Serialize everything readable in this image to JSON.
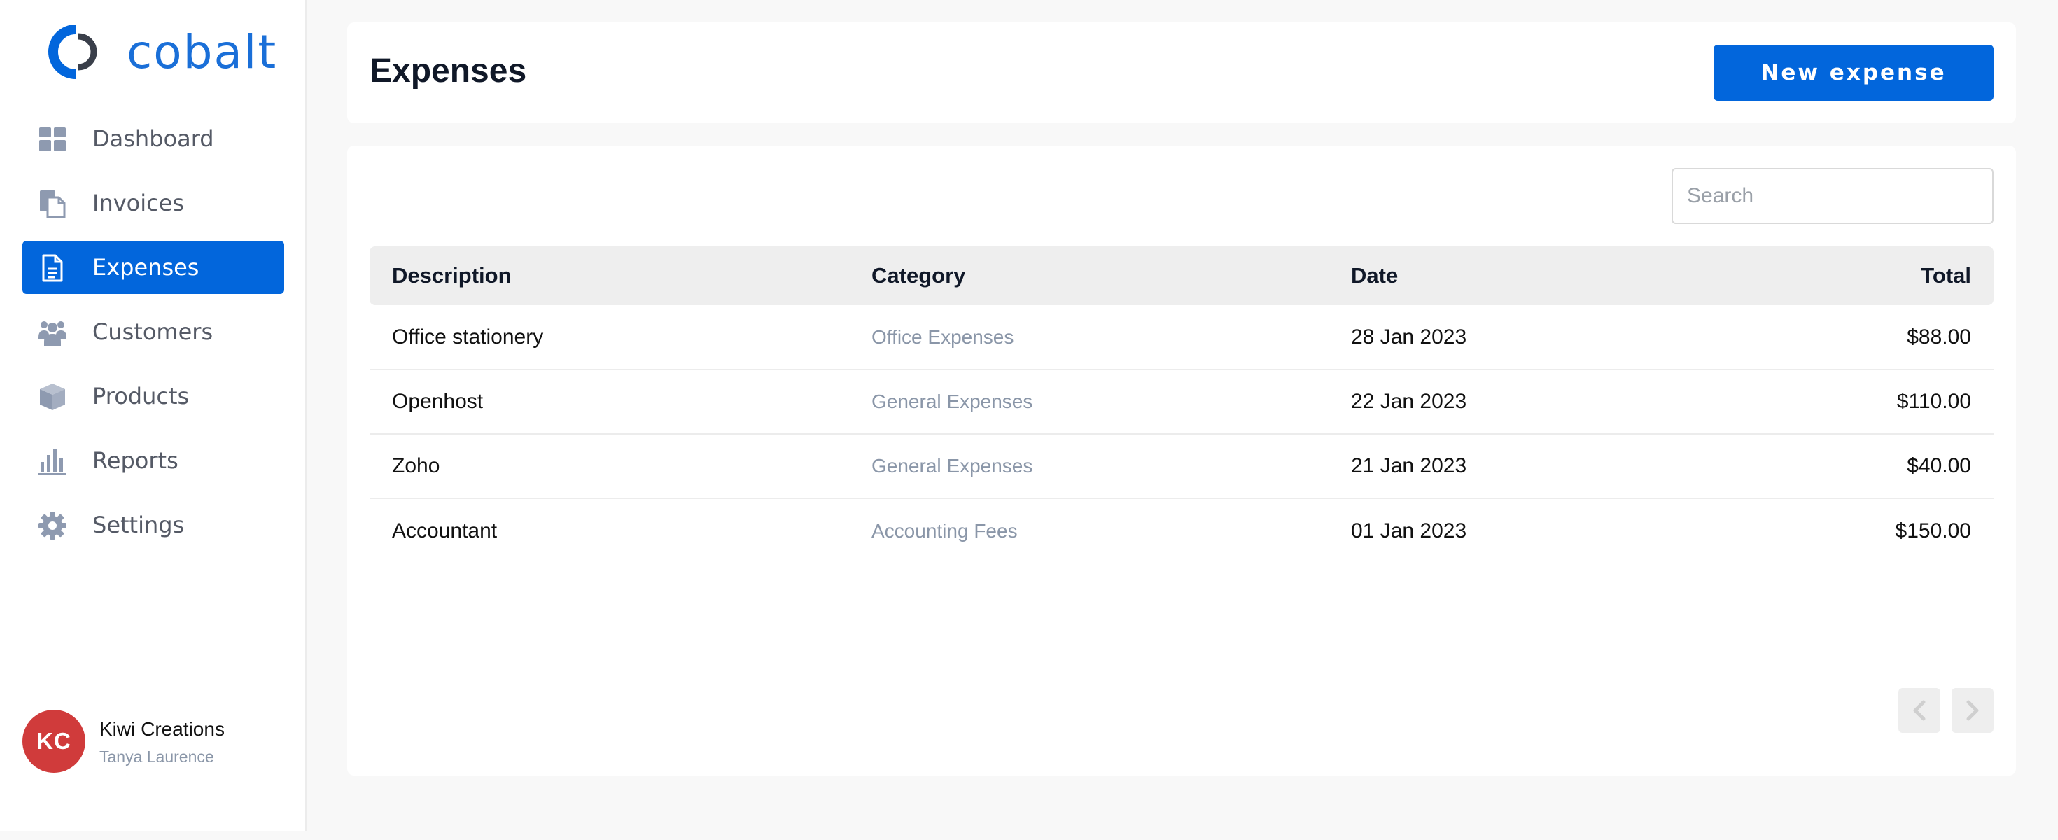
{
  "brand": {
    "name": "cobalt",
    "color": "#1a6fd8"
  },
  "sidebar": {
    "items": [
      {
        "label": "Dashboard",
        "icon": "dashboard-icon",
        "active": false
      },
      {
        "label": "Invoices",
        "icon": "invoices-icon",
        "active": false
      },
      {
        "label": "Expenses",
        "icon": "expenses-icon",
        "active": true
      },
      {
        "label": "Customers",
        "icon": "customers-icon",
        "active": false
      },
      {
        "label": "Products",
        "icon": "products-icon",
        "active": false
      },
      {
        "label": "Reports",
        "icon": "reports-icon",
        "active": false
      },
      {
        "label": "Settings",
        "icon": "settings-icon",
        "active": false
      }
    ]
  },
  "user": {
    "initials": "KC",
    "company": "Kiwi Creations",
    "name": "Tanya Laurence",
    "avatar_color": "#d03b3b"
  },
  "header": {
    "title": "Expenses",
    "new_button_label": "New expense"
  },
  "search": {
    "placeholder": "Search",
    "value": ""
  },
  "table": {
    "columns": [
      "Description",
      "Category",
      "Date",
      "Total"
    ],
    "rows": [
      {
        "description": "Office stationery",
        "category": "Office Expenses",
        "date": "28 Jan 2023",
        "total": "$88.00"
      },
      {
        "description": "Openhost",
        "category": "General Expenses",
        "date": "22 Jan 2023",
        "total": "$110.00"
      },
      {
        "description": "Zoho",
        "category": "General Expenses",
        "date": "21 Jan 2023",
        "total": "$40.00"
      },
      {
        "description": "Accountant",
        "category": "Accounting Fees",
        "date": "01 Jan 2023",
        "total": "$150.00"
      }
    ]
  },
  "pagination": {
    "prev_icon": "chevron-left-icon",
    "next_icon": "chevron-right-icon"
  },
  "colors": {
    "accent": "#0266dc",
    "muted_text": "#8a96a8",
    "icon_gray": "#8e9ab0"
  }
}
